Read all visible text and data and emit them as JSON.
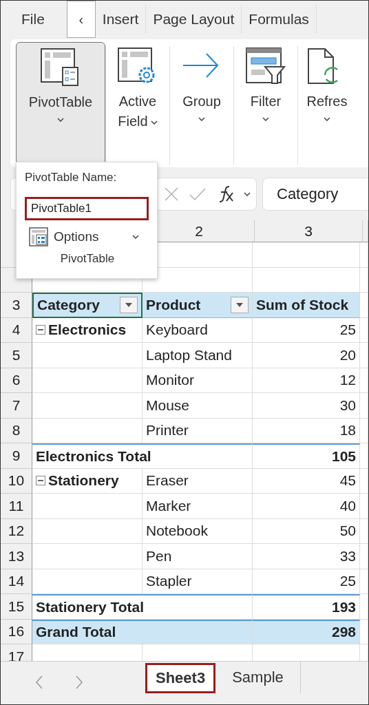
{
  "ribbon_tabs": [
    {
      "label": "File",
      "kind": "tab"
    },
    {
      "label": "‹",
      "kind": "scroll"
    },
    {
      "label": "Insert",
      "kind": "tab"
    },
    {
      "label": "Page Layout",
      "kind": "tab"
    },
    {
      "label": "Formulas",
      "kind": "tab"
    }
  ],
  "ribbon_buttons": [
    {
      "label": "PivotTable",
      "kind": "pivot",
      "selected": true
    },
    {
      "label": "Active Field",
      "kind": "field",
      "selected": false
    },
    {
      "label": "Group",
      "kind": "group",
      "selected": false
    },
    {
      "label": "Filter",
      "kind": "filter",
      "selected": false
    },
    {
      "label": "Refres",
      "kind": "refresh",
      "selected": false
    }
  ],
  "popup": {
    "title": "PivotTable Name:",
    "name_value": "PivotTable1",
    "options_label": "Options",
    "group_label": "PivotTable"
  },
  "formula_bar": {
    "value": "Category"
  },
  "column_headers": [
    "2",
    "3"
  ],
  "rows": [
    {
      "kind": "empty"
    },
    {
      "kind": "empty"
    },
    {
      "number": "3",
      "kind": "header",
      "cells": [
        {
          "text": "Category",
          "filter": true,
          "selected": true
        },
        {
          "text": "Product",
          "filter": true,
          "selected": false
        },
        {
          "text": "Sum of Stock",
          "filter": false,
          "selected": false
        }
      ]
    },
    {
      "number": "4",
      "kind": "group",
      "expanded": true,
      "cells": [
        {
          "text": "Electronics"
        },
        {
          "text": "Keyboard"
        },
        {
          "text": "25"
        }
      ]
    },
    {
      "number": "5",
      "kind": "item",
      "cells": [
        {},
        {
          "text": "Laptop Stand"
        },
        {
          "text": "20"
        }
      ]
    },
    {
      "number": "6",
      "kind": "item",
      "cells": [
        {},
        {
          "text": "Monitor"
        },
        {
          "text": "12"
        }
      ]
    },
    {
      "number": "7",
      "kind": "item",
      "cells": [
        {},
        {
          "text": "Mouse"
        },
        {
          "text": "30"
        }
      ]
    },
    {
      "number": "8",
      "kind": "item",
      "cells": [
        {},
        {
          "text": "Printer"
        },
        {
          "text": "18"
        }
      ]
    },
    {
      "number": "9",
      "kind": "subtotal",
      "cells": [
        {
          "text": "Electronics Total"
        },
        {},
        {
          "text": "105"
        }
      ]
    },
    {
      "number": "10",
      "kind": "group",
      "expanded": true,
      "cells": [
        {
          "text": "Stationery"
        },
        {
          "text": "Eraser"
        },
        {
          "text": "45"
        }
      ]
    },
    {
      "number": "11",
      "kind": "item",
      "cells": [
        {},
        {
          "text": "Marker"
        },
        {
          "text": "40"
        }
      ]
    },
    {
      "number": "12",
      "kind": "item",
      "cells": [
        {},
        {
          "text": "Notebook"
        },
        {
          "text": "50"
        }
      ]
    },
    {
      "number": "13",
      "kind": "item",
      "cells": [
        {},
        {
          "text": "Pen"
        },
        {
          "text": "33"
        }
      ]
    },
    {
      "number": "14",
      "kind": "item",
      "cells": [
        {},
        {
          "text": "Stapler"
        },
        {
          "text": "25"
        }
      ]
    },
    {
      "number": "15",
      "kind": "subtotal",
      "cells": [
        {
          "text": "Stationery Total"
        },
        {},
        {
          "text": "193"
        }
      ]
    },
    {
      "number": "16",
      "kind": "grand",
      "cells": [
        {
          "text": "Grand Total"
        },
        {},
        {
          "text": "298"
        }
      ]
    },
    {
      "number": "17",
      "kind": "empty"
    }
  ],
  "sheet_tabs": [
    {
      "label": "Sheet3",
      "selected": true
    },
    {
      "label": "Sample",
      "selected": false
    }
  ]
}
